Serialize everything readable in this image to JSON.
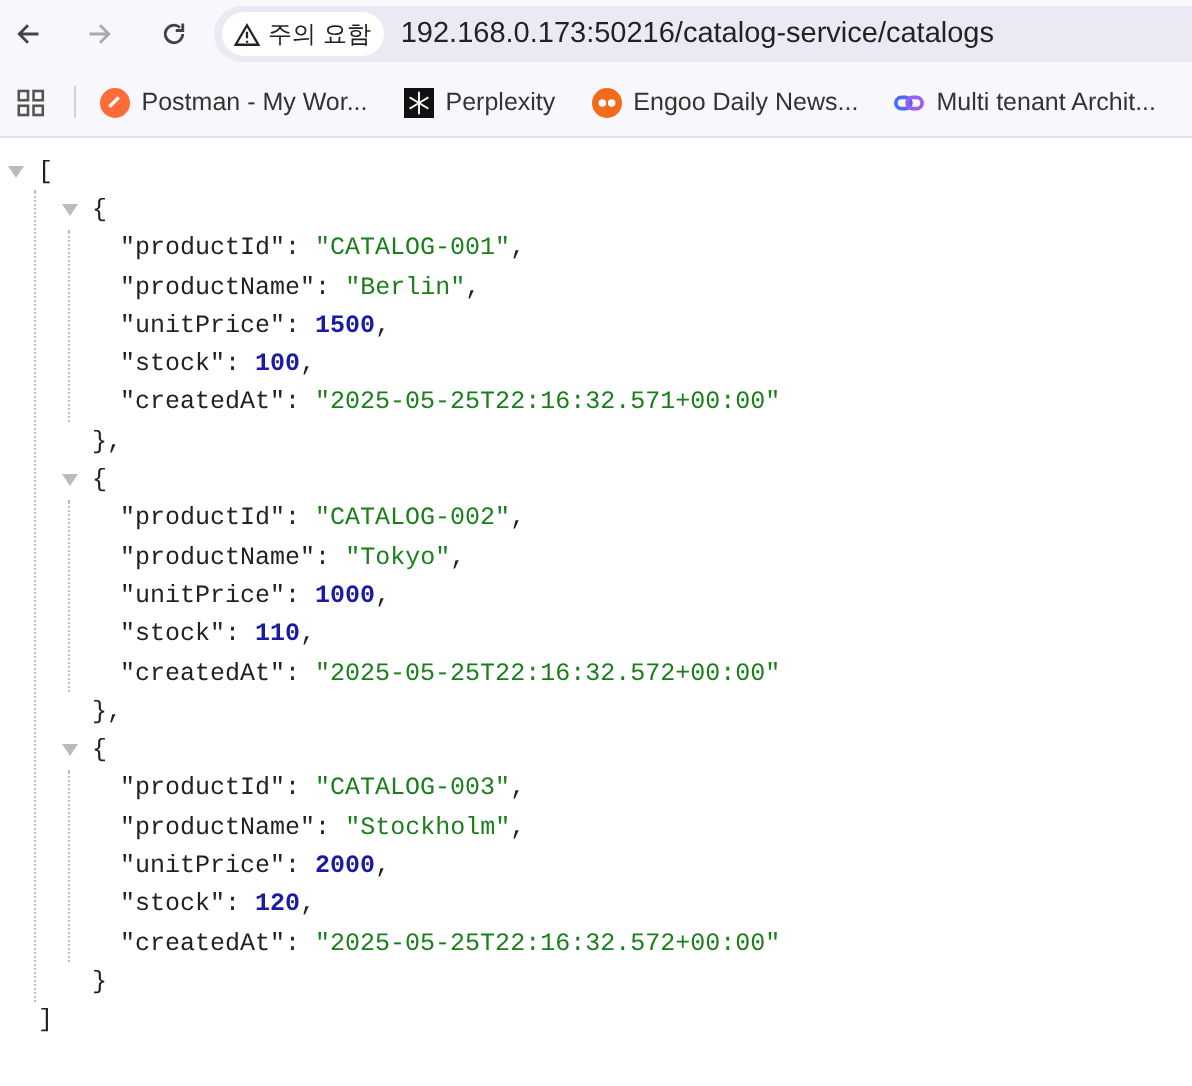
{
  "toolbar": {
    "security_chip": "주의 요함",
    "url": "192.168.0.173:50216/catalog-service/catalogs"
  },
  "bookmarks": [
    {
      "label": "Postman - My Wor...",
      "kind": "postman"
    },
    {
      "label": "Perplexity",
      "kind": "perplexity"
    },
    {
      "label": "Engoo Daily News...",
      "kind": "engoo"
    },
    {
      "label": "Multi tenant Archit...",
      "kind": "link"
    }
  ],
  "json_view": {
    "open": "[",
    "close": "]",
    "expanded": true,
    "objects": [
      {
        "open": "{",
        "close": "},",
        "expanded": true,
        "lines": [
          {
            "key": "\"productId\"",
            "colon": ":",
            "value": "\"CATALOG-001\"",
            "kind": "string",
            "comma": ","
          },
          {
            "key": "\"productName\"",
            "colon": ":",
            "value": "\"Berlin\"",
            "kind": "string",
            "comma": ","
          },
          {
            "key": "\"unitPrice\"",
            "colon": ":",
            "value": "1500",
            "kind": "number",
            "comma": ","
          },
          {
            "key": "\"stock\"",
            "colon": ":",
            "value": "100",
            "kind": "number",
            "comma": ","
          },
          {
            "key": "\"createdAt\"",
            "colon": ":",
            "value": "\"2025-05-25T22:16:32.571+00:00\"",
            "kind": "string"
          }
        ]
      },
      {
        "open": "{",
        "close": "},",
        "expanded": true,
        "lines": [
          {
            "key": "\"productId\"",
            "colon": ":",
            "value": "\"CATALOG-002\"",
            "kind": "string",
            "comma": ","
          },
          {
            "key": "\"productName\"",
            "colon": ":",
            "value": "\"Tokyo\"",
            "kind": "string",
            "comma": ","
          },
          {
            "key": "\"unitPrice\"",
            "colon": ":",
            "value": "1000",
            "kind": "number",
            "comma": ","
          },
          {
            "key": "\"stock\"",
            "colon": ":",
            "value": "110",
            "kind": "number",
            "comma": ","
          },
          {
            "key": "\"createdAt\"",
            "colon": ":",
            "value": "\"2025-05-25T22:16:32.572+00:00\"",
            "kind": "string"
          }
        ]
      },
      {
        "open": "{",
        "close": "}",
        "expanded": true,
        "lines": [
          {
            "key": "\"productId\"",
            "colon": ":",
            "value": "\"CATALOG-003\"",
            "kind": "string",
            "comma": ","
          },
          {
            "key": "\"productName\"",
            "colon": ":",
            "value": "\"Stockholm\"",
            "kind": "string",
            "comma": ","
          },
          {
            "key": "\"unitPrice\"",
            "colon": ":",
            "value": "2000",
            "kind": "number",
            "comma": ","
          },
          {
            "key": "\"stock\"",
            "colon": ":",
            "value": "120",
            "kind": "number",
            "comma": ","
          },
          {
            "key": "\"createdAt\"",
            "colon": ":",
            "value": "\"2025-05-25T22:16:32.572+00:00\"",
            "kind": "string"
          }
        ]
      }
    ]
  }
}
